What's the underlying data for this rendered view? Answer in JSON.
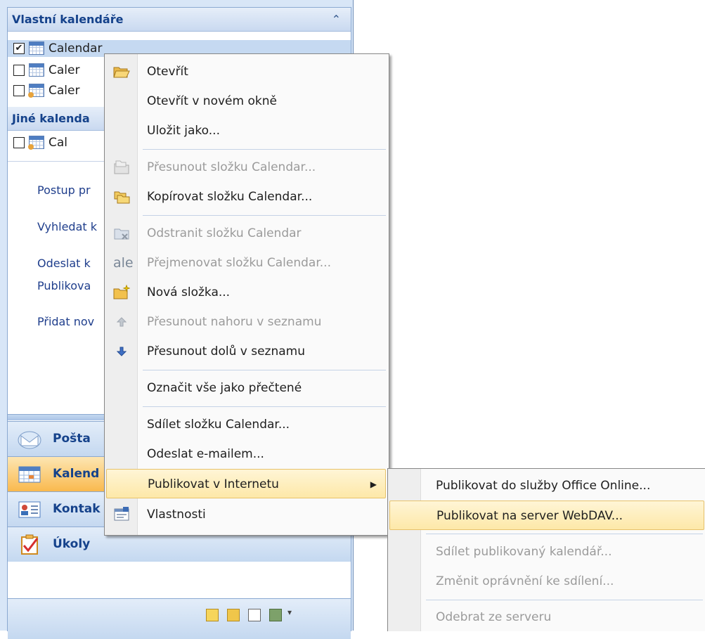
{
  "nav": {
    "own_calendars_header": "Vlastní kalendáře",
    "collapse_icon": "double-chevron-up-icon",
    "own_calendars": [
      {
        "label": "Calendar",
        "checked": true
      },
      {
        "label": "Caler",
        "checked": false
      },
      {
        "label": "Caler",
        "checked": false
      }
    ],
    "other_calendars_header": "Jiné kalenda",
    "other_calendars": [
      {
        "label": "Cal",
        "checked": false
      }
    ],
    "links": [
      "Postup pr",
      "Vyhledat k",
      "Odeslat k",
      "Publikova",
      "Přidat nov"
    ],
    "buttons": {
      "mail": "Pošta",
      "calendar": "Kalend",
      "contacts": "Kontak",
      "tasks": "Úkoly"
    },
    "checkmark": "✔"
  },
  "context_menu": {
    "items": [
      {
        "label": "Otevřít",
        "icon": "open-folder-icon"
      },
      {
        "label": "Otevřít v novém okně",
        "icon": ""
      },
      {
        "label": "Uložit jako...",
        "icon": ""
      },
      {
        "label": "Přesunout složku Calendar...",
        "icon": "move-folder-icon",
        "disabled": true
      },
      {
        "label": "Kopírovat složku Calendar...",
        "icon": "copy-folder-icon"
      },
      {
        "label": "Odstranit složku Calendar",
        "icon": "delete-folder-icon",
        "disabled": true
      },
      {
        "label": "Přejmenovat složku Calendar...",
        "icon": "rename-icon",
        "disabled": true
      },
      {
        "label": "Nová složka...",
        "icon": "new-folder-icon"
      },
      {
        "label": "Přesunout nahoru v seznamu",
        "icon": "arrow-up-icon",
        "disabled": true
      },
      {
        "label": "Přesunout dolů v seznamu",
        "icon": "arrow-down-icon"
      },
      {
        "label": "Označit vše jako přečtené",
        "icon": ""
      },
      {
        "label": "Sdílet složku Calendar...",
        "icon": ""
      },
      {
        "label": "Odeslat e-mailem...",
        "icon": ""
      },
      {
        "label": "Publikovat v Internetu",
        "icon": "",
        "submenu": true
      },
      {
        "label": "Vlastnosti",
        "icon": "properties-icon"
      }
    ],
    "submenu_arrow": "▶"
  },
  "submenu": {
    "items": [
      {
        "label": "Publikovat do služby Office Online..."
      },
      {
        "label": "Publikovat na server WebDAV..."
      },
      {
        "label": "Sdílet publikovaný kalendář...",
        "disabled": true
      },
      {
        "label": "Změnit oprávnění ke sdílení...",
        "disabled": true
      },
      {
        "label": "Odebrat ze serveru",
        "disabled": true
      }
    ]
  },
  "rename_icon_glyph": "ale"
}
